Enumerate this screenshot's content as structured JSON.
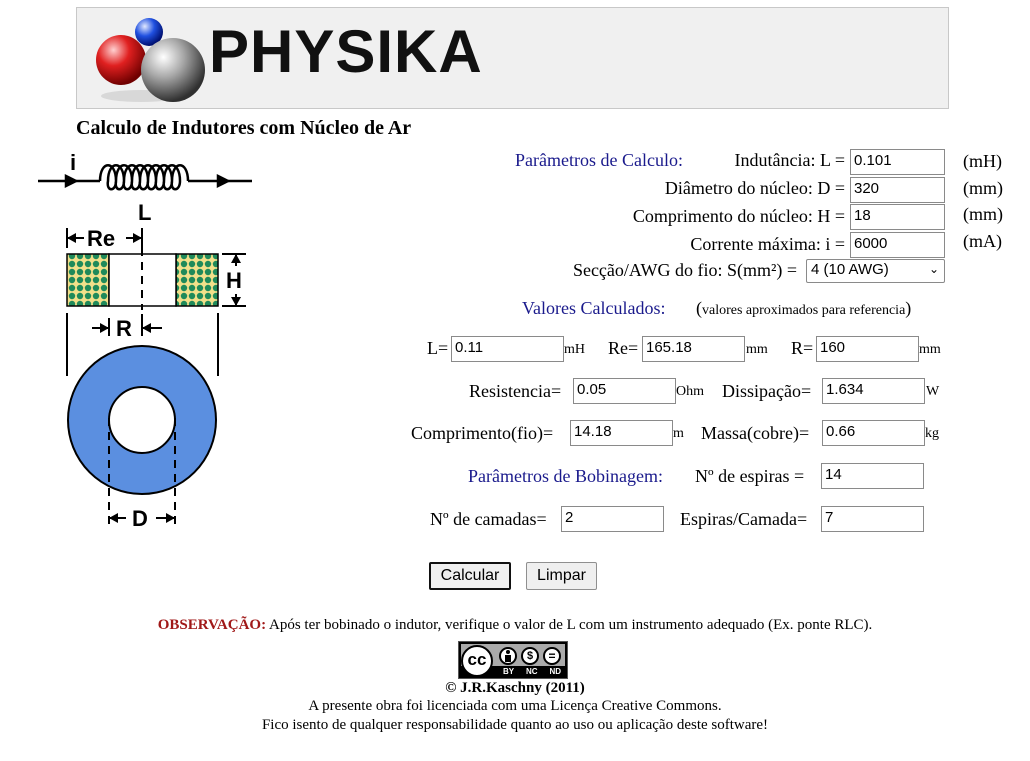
{
  "header": {
    "logo_text": "PHYSIKA"
  },
  "title": "Calculo de Indutores com Núcleo de Ar",
  "diagram": {
    "label_i": "i",
    "label_L": "L",
    "label_Re": "Re",
    "label_H": "H",
    "label_R": "R",
    "label_D": "D"
  },
  "calc_params": {
    "section": "Parâmetros de Calculo:",
    "inductance": {
      "label": "Indutância: L =",
      "value": "0.101",
      "unit": "(mH)"
    },
    "diameter": {
      "label": "Diâmetro do núcleo: D =",
      "value": "320",
      "unit": "(mm)"
    },
    "length": {
      "label": "Comprimento do núcleo: H =",
      "value": "18",
      "unit": "(mm)"
    },
    "current": {
      "label": "Corrente máxima: i =",
      "value": "6000",
      "unit": "(mA)"
    },
    "wire": {
      "label": "Secção/AWG do fio: S(mm²) =",
      "selected": "4 (10 AWG)"
    }
  },
  "calculated": {
    "section": "Valores Calculados:",
    "note_open": "(",
    "note": "valores aproximados para referencia",
    "note_close": ")",
    "L": {
      "label": "L=",
      "value": "0.11",
      "unit": "mH"
    },
    "Re": {
      "label": "Re=",
      "value": "165.18",
      "unit": "mm"
    },
    "R": {
      "label": "R=",
      "value": "160",
      "unit": "mm"
    },
    "resistance": {
      "label": "Resistencia=",
      "value": "0.05",
      "unit": "Ohm"
    },
    "dissipation": {
      "label": "Dissipação=",
      "value": "1.634",
      "unit": "W"
    },
    "wire_length": {
      "label": "Comprimento(fio)=",
      "value": "14.18",
      "unit": "m"
    },
    "mass": {
      "label": "Massa(cobre)=",
      "value": "0.66",
      "unit": "kg"
    }
  },
  "winding": {
    "section": "Parâmetros de Bobinagem:",
    "turns": {
      "label": "Nº de espiras =",
      "value": "14"
    },
    "layers": {
      "label": "Nº de camadas=",
      "value": "2"
    },
    "turns_per_layer": {
      "label": "Espiras/Camada=",
      "value": "7"
    }
  },
  "buttons": {
    "calculate": "Calcular",
    "clear": "Limpar"
  },
  "observation": {
    "prefix": "OBSERVAÇÃO:",
    "text": " Após ter bobinado o indutor, verifique o valor de L com um instrumento adequado (Ex. ponte RLC)."
  },
  "footer": {
    "cc_badge": {
      "cc": "cc",
      "by": "BY",
      "nc": "NC",
      "nd": "ND"
    },
    "copyright": "© J.R.Kaschny (2011)",
    "license": "A presente obra foi licenciada com uma Licença Creative Commons.",
    "disclaimer": "Fico isento de qualquer responsabilidade quanto ao uso ou aplicação deste software!"
  },
  "colors": {
    "section_label": "#1a1a8c",
    "observation": "#a01818",
    "core_blue": "#5b8fe0",
    "winding_green": "#1f8a5a",
    "winding_yellow": "#f2e08a"
  }
}
